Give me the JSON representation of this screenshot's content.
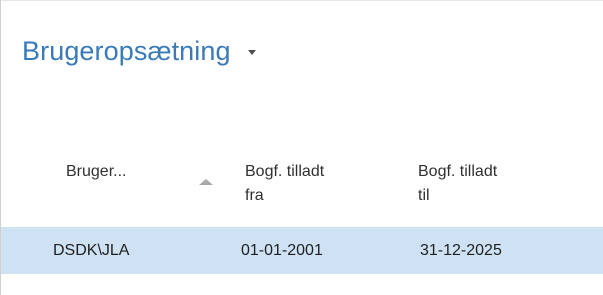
{
  "page": {
    "title": "Brugeropsætning",
    "title_menu_icon": "chevron-down-icon"
  },
  "table": {
    "columns": [
      {
        "line1": "Bruger...",
        "line2": "",
        "sort": "ascending"
      },
      {
        "line1": "Bogf. tilladt",
        "line2": "fra"
      },
      {
        "line1": "Bogf. tilladt",
        "line2": "til"
      }
    ],
    "rows": [
      {
        "user": "DSDK\\JLA",
        "from": "01-01-2001",
        "to": "31-12-2025",
        "selected": true
      }
    ]
  },
  "colors": {
    "title": "#3b7ab8",
    "selected_row": "#cfe2f4",
    "text": "#1f1f1f"
  }
}
